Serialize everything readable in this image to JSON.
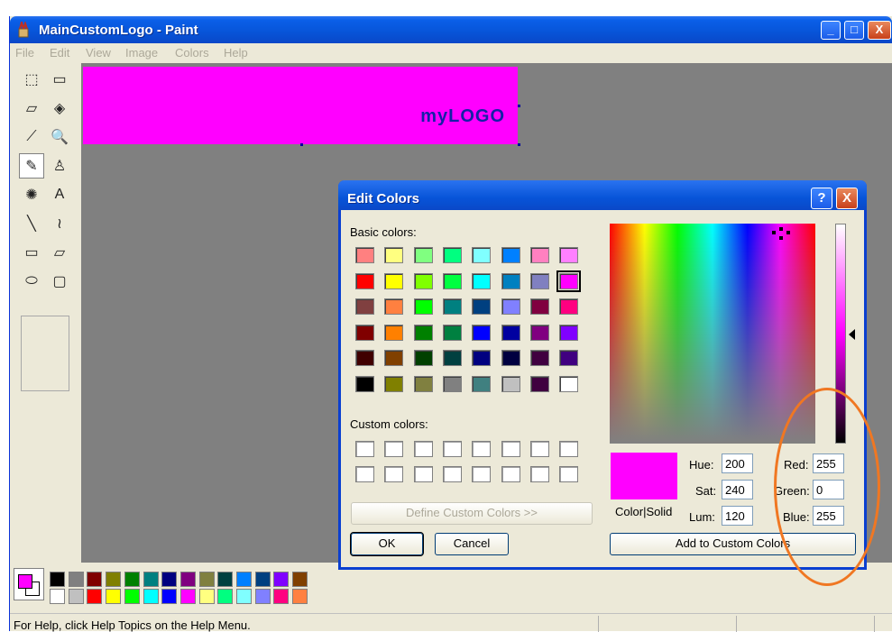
{
  "window": {
    "title": "MainCustomLogo - Paint",
    "minimize_label": "_",
    "maximize_label": "□",
    "close_label": "X"
  },
  "menu": [
    "File",
    "Edit",
    "View",
    "Image",
    "Colors",
    "Help"
  ],
  "canvas": {
    "logo_text": "myLOGO",
    "fill_color": "#ff00ff",
    "text_color": "#1520a6"
  },
  "tools": [
    "free-form-select-icon",
    "rectangle-select-icon",
    "eraser-icon",
    "fill-bucket-icon",
    "color-picker-icon",
    "magnifier-icon",
    "pencil-icon",
    "brush-icon",
    "airbrush-icon",
    "text-icon",
    "line-icon",
    "curve-icon",
    "rectangle-icon",
    "polygon-icon",
    "ellipse-icon",
    "rounded-rectangle-icon"
  ],
  "tool_glyphs": [
    "⬚",
    "▭",
    "▱",
    "◈",
    "⟋",
    "🔍",
    "✎",
    "♙",
    "✺",
    "A",
    "╲",
    "≀",
    "▭",
    "▱",
    "⬭",
    "▢"
  ],
  "selected_tool": "pencil-icon",
  "palette": {
    "foreground": "#ff00ff",
    "background": "#ffffff",
    "row1": [
      "#000000",
      "#808080",
      "#800000",
      "#808000",
      "#008000",
      "#008080",
      "#000080",
      "#800080",
      "#808040",
      "#004040",
      "#0080ff",
      "#004080",
      "#8000ff",
      "#804000"
    ],
    "row2": [
      "#ffffff",
      "#c0c0c0",
      "#ff0000",
      "#ffff00",
      "#00ff00",
      "#00ffff",
      "#0000ff",
      "#ff00ff",
      "#ffff80",
      "#00ff80",
      "#80ffff",
      "#8080ff",
      "#ff0080",
      "#ff8040"
    ]
  },
  "status": {
    "text": "For Help, click Help Topics on the Help Menu."
  },
  "dialog": {
    "title": "Edit Colors",
    "help_label": "?",
    "close_label": "X",
    "basic_colors_label": "Basic colors:",
    "custom_colors_label": "Custom colors:",
    "basic_colors": [
      [
        "#ff8080",
        "#ffff80",
        "#80ff80",
        "#00ff80",
        "#80ffff",
        "#0080ff",
        "#ff80c0",
        "#ff80ff"
      ],
      [
        "#ff0000",
        "#ffff00",
        "#80ff00",
        "#00ff40",
        "#00ffff",
        "#0080c0",
        "#8080c0",
        "#ff00ff"
      ],
      [
        "#804040",
        "#ff8040",
        "#00ff00",
        "#008080",
        "#004080",
        "#8080ff",
        "#800040",
        "#ff0080"
      ],
      [
        "#800000",
        "#ff8000",
        "#008000",
        "#008040",
        "#0000ff",
        "#0000a0",
        "#800080",
        "#8000ff"
      ],
      [
        "#400000",
        "#804000",
        "#004000",
        "#004040",
        "#000080",
        "#000040",
        "#400040",
        "#400080"
      ],
      [
        "#000000",
        "#808000",
        "#808040",
        "#808080",
        "#408080",
        "#c0c0c0",
        "#400040",
        "#ffffff"
      ]
    ],
    "selected_basic": {
      "row": 1,
      "col": 7
    },
    "define_custom_label": "Define Custom Colors >>",
    "ok_label": "OK",
    "cancel_label": "Cancel",
    "color_solid_label": "Color|Solid",
    "hue_label": "Hue:",
    "sat_label": "Sat:",
    "lum_label": "Lum:",
    "red_label": "Red:",
    "green_label": "Green:",
    "blue_label": "Blue:",
    "hue": "200",
    "sat": "240",
    "lum": "120",
    "red": "255",
    "green": "0",
    "blue": "255",
    "add_custom_label": "Add to Custom Colors",
    "preview_color": "#ff00ff"
  },
  "annotation_color": "#f07722"
}
